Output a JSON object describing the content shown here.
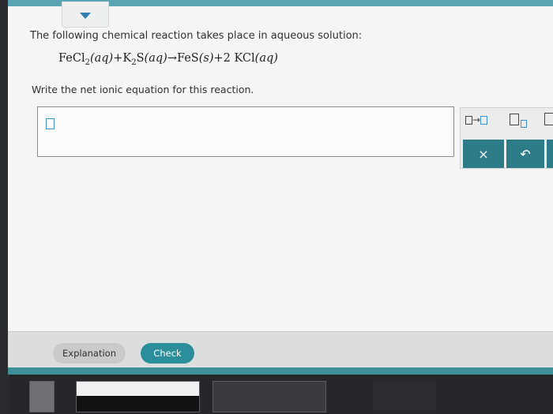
{
  "question": {
    "intro": "The following chemical reaction takes place in aqueous solution:",
    "equation": {
      "r1": "FeCl",
      "r1_sub": "2",
      "r1_state": "(aq)",
      "plus1": "+",
      "r2": "K",
      "r2_sub": "2",
      "r2_tail": "S",
      "r2_state": "(aq)",
      "arrow": "→",
      "p1": "FeS",
      "p1_state": "(s)",
      "plus2": "+",
      "p2": "2 KCl",
      "p2_state": "(aq)"
    },
    "instruction": "Write the net ionic equation for this reaction."
  },
  "toolbar": {
    "arrow_glyph": "→",
    "clear_glyph": "×",
    "undo_glyph": "↶"
  },
  "footer": {
    "explanation_label": "Explanation",
    "check_label": "Check"
  },
  "icons": [
    "caret-down-icon",
    "reaction-arrow-icon",
    "subscript-icon",
    "close-icon",
    "undo-icon"
  ],
  "colors": {
    "accent": "#2a8f9a",
    "toolbar_button": "#2d7c8a",
    "cursor": "#3b8fd0"
  }
}
